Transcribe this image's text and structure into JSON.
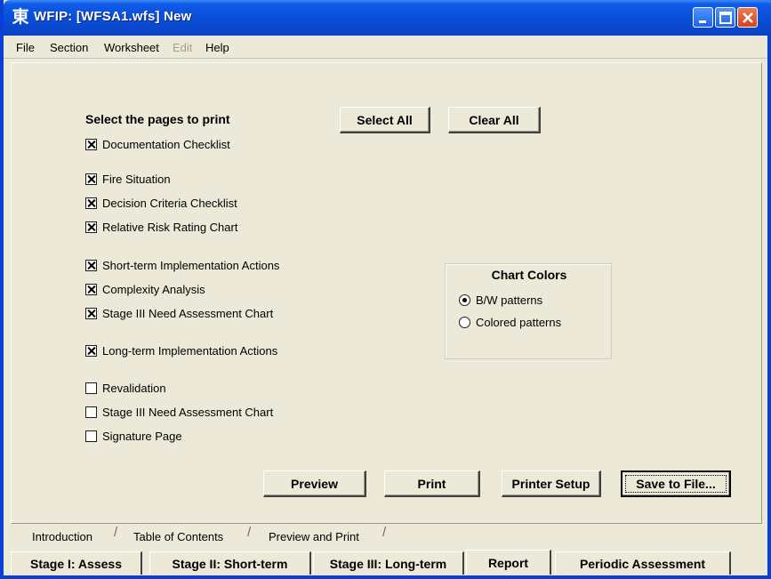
{
  "window": {
    "title": "WFIP:  [WFSA1.wfs]  New",
    "app_icon": "wfip-app-icon"
  },
  "menu": [
    {
      "label": "File",
      "enabled": true
    },
    {
      "label": "Section",
      "enabled": true
    },
    {
      "label": "Worksheet",
      "enabled": true
    },
    {
      "label": "Edit",
      "enabled": false
    },
    {
      "label": "Help",
      "enabled": true
    }
  ],
  "print_panel": {
    "heading": "Select the pages to print",
    "select_all_label": "Select All",
    "clear_all_label": "Clear All",
    "pages": [
      {
        "label": "Documentation Checklist",
        "checked": true
      },
      {
        "label": "Fire Situation",
        "checked": true
      },
      {
        "label": "Decision Criteria Checklist",
        "checked": true
      },
      {
        "label": "Relative Risk Rating Chart",
        "checked": true
      },
      {
        "label": "Short-term Implementation Actions",
        "checked": true
      },
      {
        "label": "Complexity Analysis",
        "checked": true
      },
      {
        "label": "Stage III Need Assessment Chart",
        "checked": true
      },
      {
        "label": "Long-term Implementation Actions",
        "checked": true
      },
      {
        "label": "Revalidation",
        "checked": false
      },
      {
        "label": "Stage III Need Assessment Chart",
        "checked": false
      },
      {
        "label": "Signature Page",
        "checked": false
      }
    ],
    "chart_colors": {
      "title": "Chart Colors",
      "options": [
        {
          "label": "B/W patterns",
          "selected": true
        },
        {
          "label": "Colored patterns",
          "selected": false
        }
      ]
    },
    "actions": {
      "preview_label": "Preview",
      "print_label": "Print",
      "printer_setup_label": "Printer Setup",
      "save_to_file_label": "Save to File..."
    }
  },
  "sub_tabs": [
    {
      "label": "Introduction",
      "active": false
    },
    {
      "label": "Table of Contents",
      "active": false
    },
    {
      "label": "Preview and Print",
      "active": true
    }
  ],
  "stage_tabs": [
    {
      "label": "Stage I: Assess",
      "active": false
    },
    {
      "label": "Stage II: Short-term",
      "active": false
    },
    {
      "label": "Stage III: Long-term",
      "active": false
    },
    {
      "label": "Report",
      "active": true
    },
    {
      "label": "Periodic Assessment",
      "active": false
    }
  ],
  "colors": {
    "titlebar": "#0a4fd9",
    "face": "#ece9d8",
    "close_button": "#d3431c"
  }
}
